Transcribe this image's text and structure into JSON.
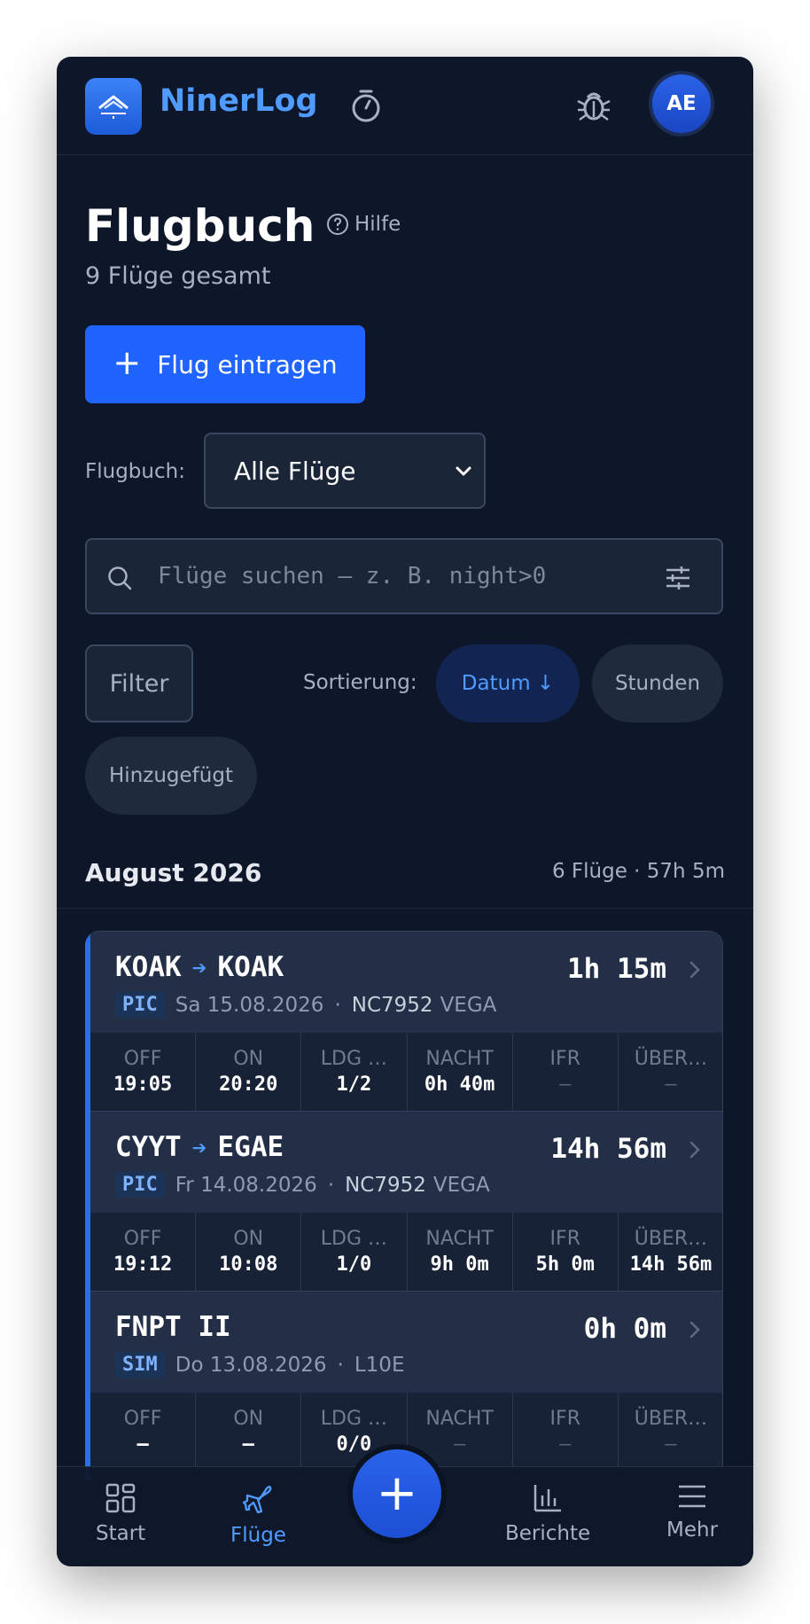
{
  "app": {
    "name": "NinerLog",
    "avatar_initials": "AE"
  },
  "page": {
    "title": "Flugbuch",
    "help_label": "Hilfe",
    "subtitle": "9 Flüge gesamt",
    "add_button_label": "Flug eintragen",
    "logbook_label": "Flugbuch:",
    "logbook_selected": "Alle Flüge",
    "search_placeholder": "Flüge suchen — z. B. night>0",
    "filter_label": "Filter",
    "sort_label": "Sortierung:",
    "sort_options": [
      "Datum ↓",
      "Stunden",
      "Hinzugefügt"
    ],
    "sort_active": "Datum ↓"
  },
  "group": {
    "month": "August 2026",
    "summary": "6 Flüge · 57h 5m"
  },
  "stat_labels": [
    "OFF",
    "ON",
    "LDG …",
    "NACHT",
    "IFR",
    "ÜBER…"
  ],
  "flights": [
    {
      "from": "KOAK",
      "to": "KOAK",
      "duration": "1h 15m",
      "role": "PIC",
      "date": "Sa 15.08.2026",
      "registration": "NC7952",
      "aircraft_type": "VEGA",
      "stats": [
        "19:05",
        "20:20",
        "1/2",
        "0h 40m",
        "—",
        "—"
      ]
    },
    {
      "from": "CYYT",
      "to": "EGAE",
      "duration": "14h 56m",
      "role": "PIC",
      "date": "Fr 14.08.2026",
      "registration": "NC7952",
      "aircraft_type": "VEGA",
      "stats": [
        "19:12",
        "10:08",
        "1/0",
        "9h 0m",
        "5h 0m",
        "14h 56m"
      ]
    },
    {
      "title": "FNPT II",
      "duration": "0h 0m",
      "role": "SIM",
      "date": "Do 13.08.2026",
      "device": "L10E",
      "stats": [
        "—",
        "—",
        "0/0",
        "—",
        "—",
        "—"
      ]
    }
  ],
  "nav": {
    "items": [
      "Start",
      "Flüge",
      "Berichte",
      "Mehr"
    ],
    "active": "Flüge",
    "fab_symbol": "+"
  },
  "colors": {
    "background": "#0e1629",
    "accent": "#1f64ff",
    "accent_text": "#4f9bff",
    "card": "#232f47"
  }
}
